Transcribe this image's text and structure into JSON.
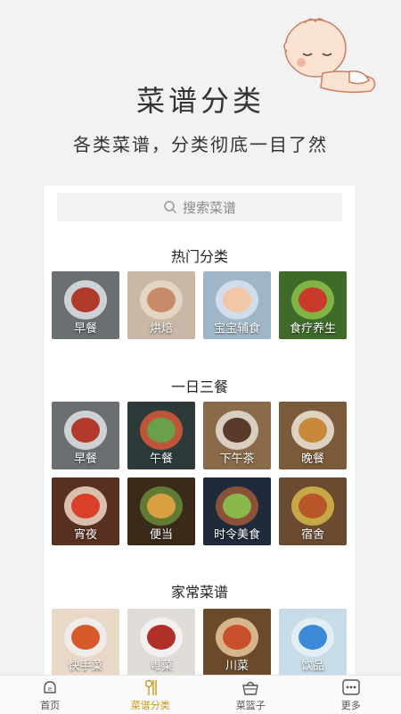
{
  "colors": {
    "accent": "#c8961a",
    "background": "#f2f2f2",
    "card": "#ffffff"
  },
  "hero": {
    "title": "菜谱分类",
    "subtitle": "各类菜谱，分类彻底一目了然"
  },
  "search": {
    "placeholder": "搜索菜谱",
    "icon": "search-icon"
  },
  "sections": [
    {
      "title": "热门分类",
      "items": [
        {
          "label": "早餐",
          "bg": "#6a6f72",
          "c1": "#b23a2a",
          "c2": "#dfe3e6"
        },
        {
          "label": "烘焙",
          "bg": "#c8b8a8",
          "c1": "#c98a6a",
          "c2": "#e8d8c8"
        },
        {
          "label": "宝宝辅食",
          "bg": "#9fb6c6",
          "c1": "#f1c7a8",
          "c2": "#d9e5ee"
        },
        {
          "label": "食疗养生",
          "bg": "#3f6a2a",
          "c1": "#c93a2a",
          "c2": "#8fc04a"
        }
      ]
    },
    {
      "title": "一日三餐",
      "items": [
        {
          "label": "早餐",
          "bg": "#6a6f72",
          "c1": "#b23a2a",
          "c2": "#dfe3e6"
        },
        {
          "label": "午餐",
          "bg": "#2c3a3a",
          "c1": "#6aa04a",
          "c2": "#d85a3a"
        },
        {
          "label": "下午茶",
          "bg": "#8a6a4a",
          "c1": "#5a3a2a",
          "c2": "#e6e0d6"
        },
        {
          "label": "晚餐",
          "bg": "#7a5a3a",
          "c1": "#c88a3a",
          "c2": "#f0e8dc"
        },
        {
          "label": "宵夜",
          "bg": "#5a3020",
          "c1": "#d8402a",
          "c2": "#f0d8c8"
        },
        {
          "label": "便当",
          "bg": "#3a2a1a",
          "c1": "#d8a040",
          "c2": "#6a8a3a"
        },
        {
          "label": "时令美食",
          "bg": "#1f2a3a",
          "c1": "#8ab84a",
          "c2": "#a0583a"
        },
        {
          "label": "宿舍",
          "bg": "#6a4a30",
          "c1": "#b8572a",
          "c2": "#d8b84a"
        }
      ]
    },
    {
      "title": "家常菜谱",
      "items": [
        {
          "label": "快手菜",
          "bg": "#e8d8c8",
          "c1": "#d85a2a",
          "c2": "#f0f0f0"
        },
        {
          "label": "粤菜",
          "bg": "#e0dcd8",
          "c1": "#b0302a",
          "c2": "#f4f4f4"
        },
        {
          "label": "川菜",
          "bg": "#6a4a2a",
          "c1": "#c8502a",
          "c2": "#e8c89a"
        },
        {
          "label": "饮品",
          "bg": "#c8dce8",
          "c1": "#3a8ad8",
          "c2": "#e8f0f6"
        }
      ]
    }
  ],
  "tabbar": [
    {
      "label": "首页",
      "icon": "home-hat-icon",
      "active": false
    },
    {
      "label": "菜谱分类",
      "icon": "utensils-icon",
      "active": true
    },
    {
      "label": "菜篮子",
      "icon": "basket-icon",
      "active": false
    },
    {
      "label": "更多",
      "icon": "more-dots-icon",
      "active": false
    }
  ]
}
